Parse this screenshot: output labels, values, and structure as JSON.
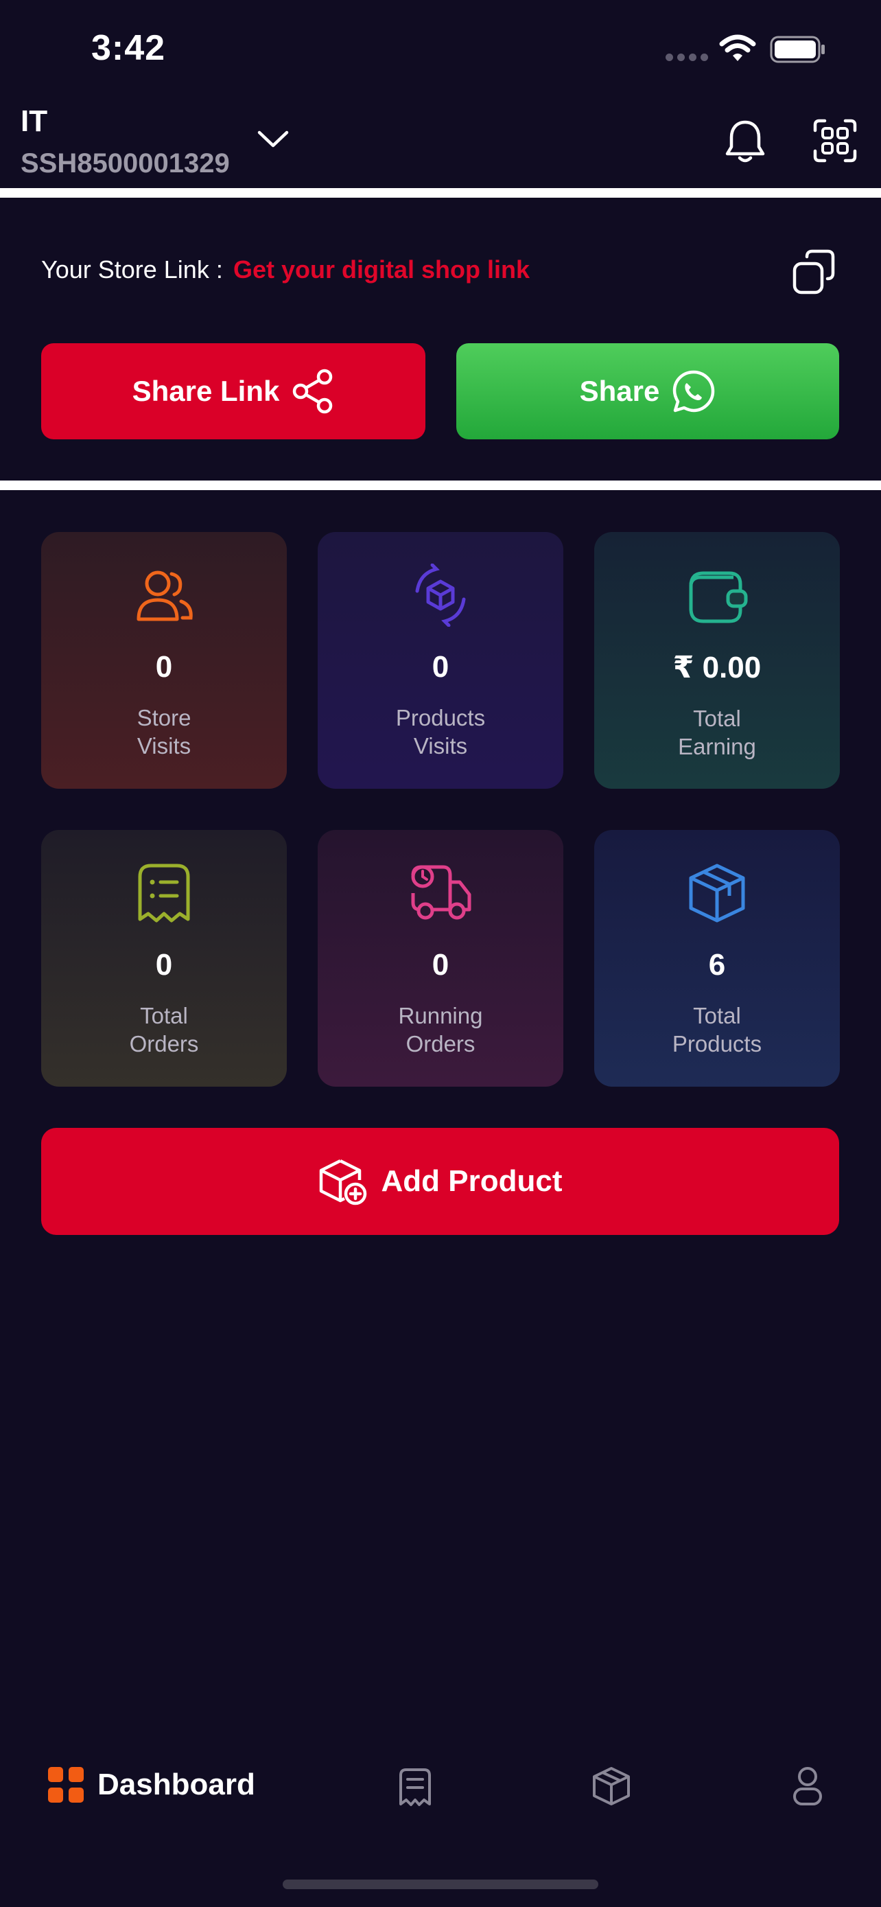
{
  "status_bar": {
    "time": "3:42"
  },
  "header": {
    "store_name": "IT",
    "store_id": "SSH8500001329"
  },
  "store_link": {
    "label": "Your Store Link :",
    "link_text": "Get your digital shop link"
  },
  "buttons": {
    "share_link": "Share Link",
    "share_whatsapp": "Share",
    "add_product": "Add Product"
  },
  "stats": [
    {
      "value": "0",
      "caption_1": "Store",
      "caption_2": "Visits",
      "color": "#f0661b",
      "icon": "users-icon"
    },
    {
      "value": "0",
      "caption_1": "Products",
      "caption_2": "Visits",
      "color": "#5a3bd6",
      "icon": "box-refresh-icon"
    },
    {
      "value": "₹ 0.00",
      "caption_1": "Total",
      "caption_2": "Earning",
      "color": "#25b38f",
      "icon": "wallet-icon"
    },
    {
      "value": "0",
      "caption_1": "Total",
      "caption_2": "Orders",
      "color": "#9bb02c",
      "icon": "receipt-icon"
    },
    {
      "value": "0",
      "caption_1": "Running",
      "caption_2": "Orders",
      "color": "#e03f8a",
      "icon": "delivery-truck-icon"
    },
    {
      "value": "6",
      "caption_1": "Total",
      "caption_2": "Products",
      "color": "#3a86e0",
      "icon": "box-icon"
    }
  ],
  "nav": {
    "dashboard": "Dashboard",
    "active_color": "#f25c13"
  }
}
